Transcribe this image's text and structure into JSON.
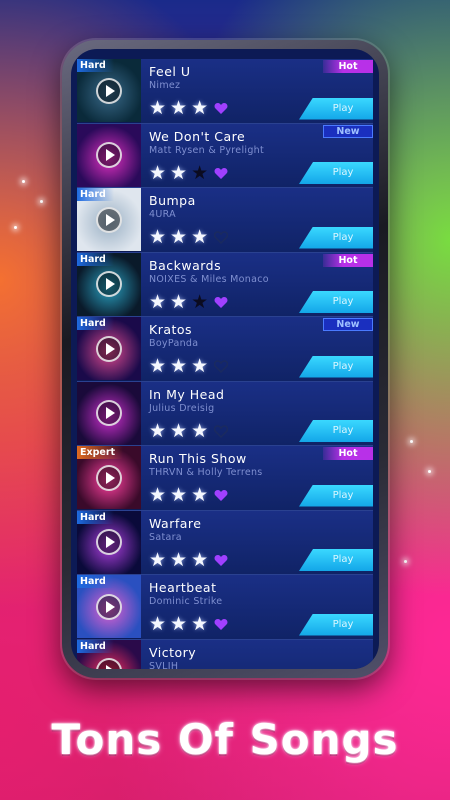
{
  "headline": "Tons Of Songs",
  "songs": [
    {
      "title": "Feel U",
      "artist": "Nimez",
      "difficulty": "Hard",
      "tag": "Hot",
      "stars": 3,
      "favorite": true,
      "play_label": "Play",
      "art_colors": [
        "#0a2a3a",
        "#3a6a8a"
      ]
    },
    {
      "title": "We Don't Care",
      "artist": "Matt Rysen & Pyrelight",
      "difficulty": "",
      "tag": "New",
      "stars": 2,
      "favorite": true,
      "play_label": "Play",
      "art_colors": [
        "#2a0a5a",
        "#e030c0"
      ]
    },
    {
      "title": "Bumpa",
      "artist": "4URA",
      "difficulty": "Hard",
      "tag": "",
      "stars": 3,
      "favorite": false,
      "play_label": "Play",
      "art_colors": [
        "#dfe6ee",
        "#9ab0c4"
      ]
    },
    {
      "title": "Backwards",
      "artist": "NOIXES & Miles Monaco",
      "difficulty": "Hard",
      "tag": "Hot",
      "stars": 2,
      "favorite": true,
      "play_label": "Play",
      "art_colors": [
        "#0a1a2a",
        "#2aa0c0"
      ]
    },
    {
      "title": "Kratos",
      "artist": "BoyPanda",
      "difficulty": "Hard",
      "tag": "New",
      "stars": 3,
      "favorite": false,
      "play_label": "Play",
      "art_colors": [
        "#1a0a4a",
        "#e04a90"
      ]
    },
    {
      "title": "In My Head",
      "artist": "Julius Dreisig",
      "difficulty": "",
      "tag": "",
      "stars": 3,
      "favorite": false,
      "play_label": "Play",
      "art_colors": [
        "#1a0a3a",
        "#d030d0"
      ]
    },
    {
      "title": "Run This Show",
      "artist": "THRVN & Holly Terrens",
      "difficulty": "Expert",
      "tag": "Hot",
      "stars": 3,
      "favorite": true,
      "play_label": "Play",
      "art_colors": [
        "#3a0a2a",
        "#ff40a0"
      ]
    },
    {
      "title": "Warfare",
      "artist": "Satara",
      "difficulty": "Hard",
      "tag": "",
      "stars": 3,
      "favorite": true,
      "play_label": "Play",
      "art_colors": [
        "#0a0a3a",
        "#b040e0"
      ]
    },
    {
      "title": "Heartbeat",
      "artist": "Dominic Strike",
      "difficulty": "Hard",
      "tag": "",
      "stars": 3,
      "favorite": true,
      "play_label": "Play",
      "art_colors": [
        "#2a50c0",
        "#e060d0"
      ]
    },
    {
      "title": "Victory",
      "artist": "SVLIH",
      "difficulty": "Hard",
      "tag": "",
      "stars": 0,
      "favorite": false,
      "play_label": "",
      "art_colors": [
        "#2a0a4a",
        "#ff3060"
      ]
    }
  ],
  "colors": {
    "hot": "#b830e8",
    "new": "#1a2fbf",
    "play": "#13a6e8",
    "heart_on": "#a040ff",
    "heart_off": "#1a2a60"
  }
}
